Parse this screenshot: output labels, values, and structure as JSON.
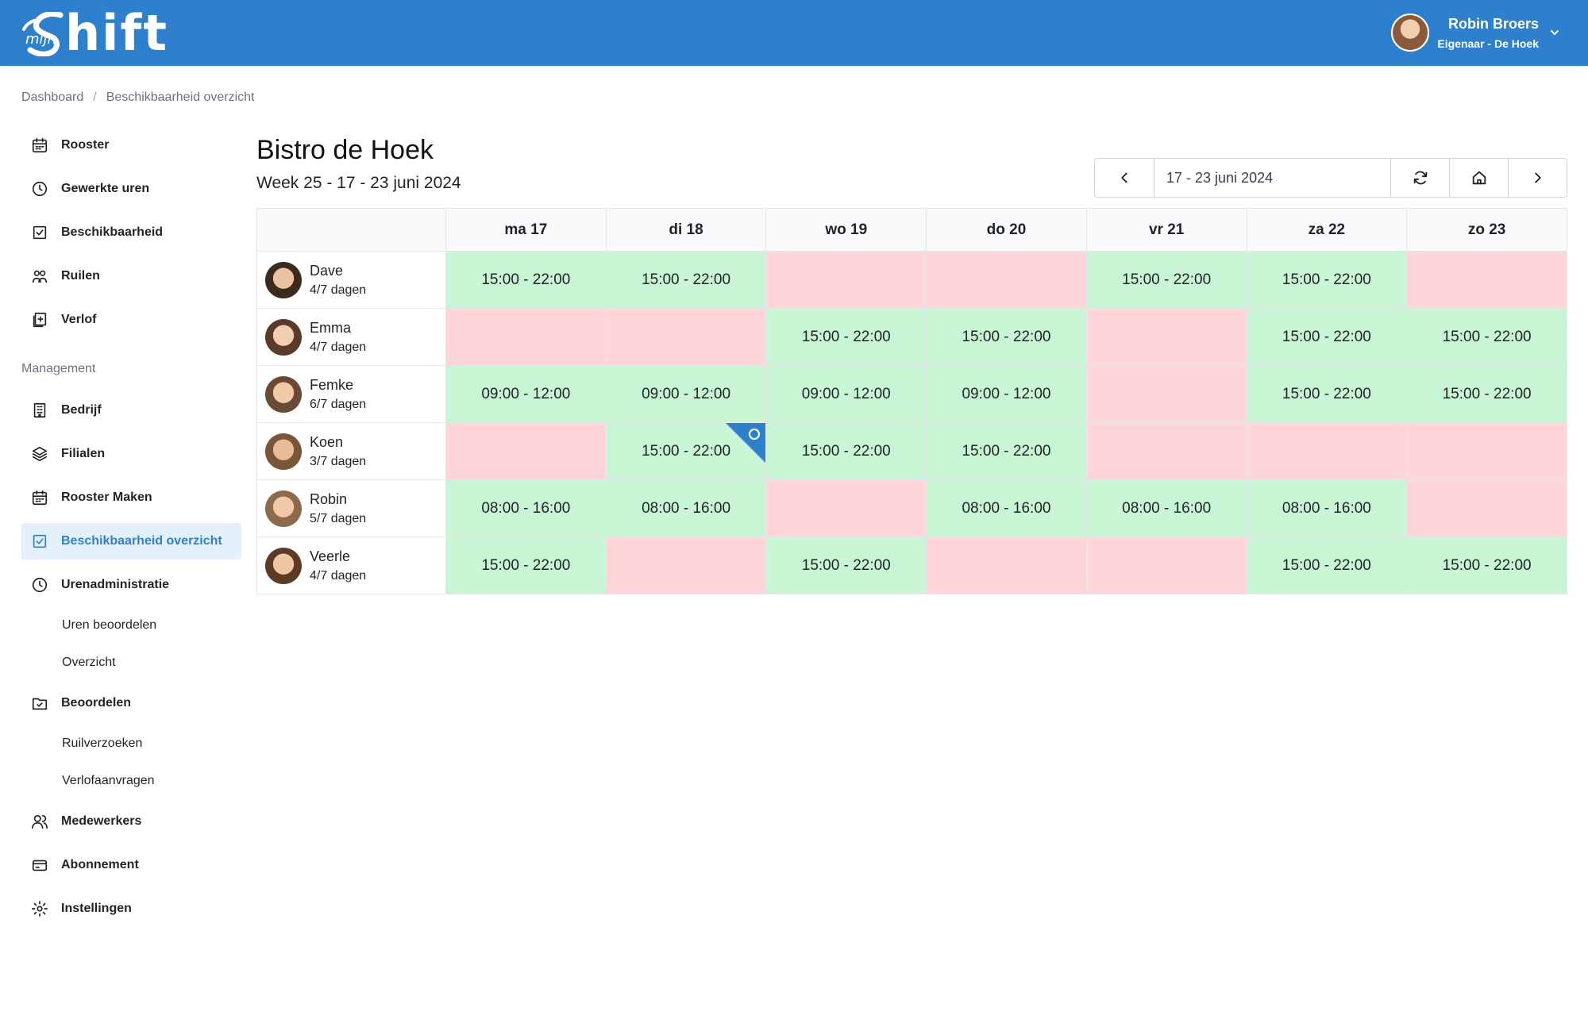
{
  "header": {
    "logo_small": "mijn",
    "logo_text": "hift",
    "user_name": "Robin Broers",
    "user_role": "Eigenaar - De Hoek"
  },
  "breadcrumb": {
    "home": "Dashboard",
    "sep": "/",
    "current": "Beschikbaarheid overzicht"
  },
  "sidebar": {
    "items": [
      {
        "label": "Rooster",
        "icon": "calendar-icon"
      },
      {
        "label": "Gewerkte uren",
        "icon": "clock-icon"
      },
      {
        "label": "Beschikbaarheid",
        "icon": "check-square-icon"
      },
      {
        "label": "Ruilen",
        "icon": "swap-users-icon"
      },
      {
        "label": "Verlof",
        "icon": "leave-icon"
      }
    ],
    "section_label": "Management",
    "management": [
      {
        "label": "Bedrijf",
        "icon": "building-icon"
      },
      {
        "label": "Filialen",
        "icon": "layers-icon"
      },
      {
        "label": "Rooster Maken",
        "icon": "calendar-icon"
      },
      {
        "label": "Beschikbaarheid overzicht",
        "icon": "check-square-icon",
        "active": true
      },
      {
        "label": "Urenadministratie",
        "icon": "clock-icon"
      }
    ],
    "uren_sub": [
      "Uren beoordelen",
      "Overzicht"
    ],
    "beoordelen": {
      "label": "Beoordelen",
      "icon": "folder-check-icon"
    },
    "beoordelen_sub": [
      "Ruilverzoeken",
      "Verlofaanvragen"
    ],
    "bottom": [
      {
        "label": "Medewerkers",
        "icon": "users-icon"
      },
      {
        "label": "Abonnement",
        "icon": "credit-card-icon"
      },
      {
        "label": "Instellingen",
        "icon": "gear-icon"
      }
    ]
  },
  "main": {
    "title": "Bistro de Hoek",
    "subtitle": "Week 25 - 17 - 23 juni 2024",
    "date_range": "17 - 23 juni 2024"
  },
  "colors": {
    "primary": "#2f80cc",
    "available": "#c8f5d3",
    "unavailable": "#fcd6d9"
  },
  "table": {
    "days": [
      "ma 17",
      "di 18",
      "wo 19",
      "do 20",
      "vr 21",
      "za 22",
      "zo 23"
    ],
    "rows": [
      {
        "name": "Dave",
        "days": "4/7 dagen",
        "cells": [
          "15:00 - 22:00",
          "15:00 - 22:00",
          "",
          "",
          "15:00 - 22:00",
          "15:00 - 22:00",
          ""
        ]
      },
      {
        "name": "Emma",
        "days": "4/7 dagen",
        "cells": [
          "",
          "",
          "15:00 - 22:00",
          "15:00 - 22:00",
          "",
          "15:00 - 22:00",
          "15:00 - 22:00"
        ]
      },
      {
        "name": "Femke",
        "days": "6/7 dagen",
        "cells": [
          "09:00 - 12:00",
          "09:00 - 12:00",
          "09:00 - 12:00",
          "09:00 - 12:00",
          "",
          "15:00 - 22:00",
          "15:00 - 22:00"
        ]
      },
      {
        "name": "Koen",
        "days": "3/7 dagen",
        "cells": [
          "",
          "15:00 - 22:00",
          "15:00 - 22:00",
          "15:00 - 22:00",
          "",
          "",
          ""
        ],
        "note_on": 1
      },
      {
        "name": "Robin",
        "days": "5/7 dagen",
        "cells": [
          "08:00 - 16:00",
          "08:00 - 16:00",
          "",
          "08:00 - 16:00",
          "08:00 - 16:00",
          "08:00 - 16:00",
          ""
        ]
      },
      {
        "name": "Veerle",
        "days": "4/7 dagen",
        "cells": [
          "15:00 - 22:00",
          "",
          "15:00 - 22:00",
          "",
          "",
          "15:00 - 22:00",
          "15:00 - 22:00"
        ]
      }
    ]
  }
}
